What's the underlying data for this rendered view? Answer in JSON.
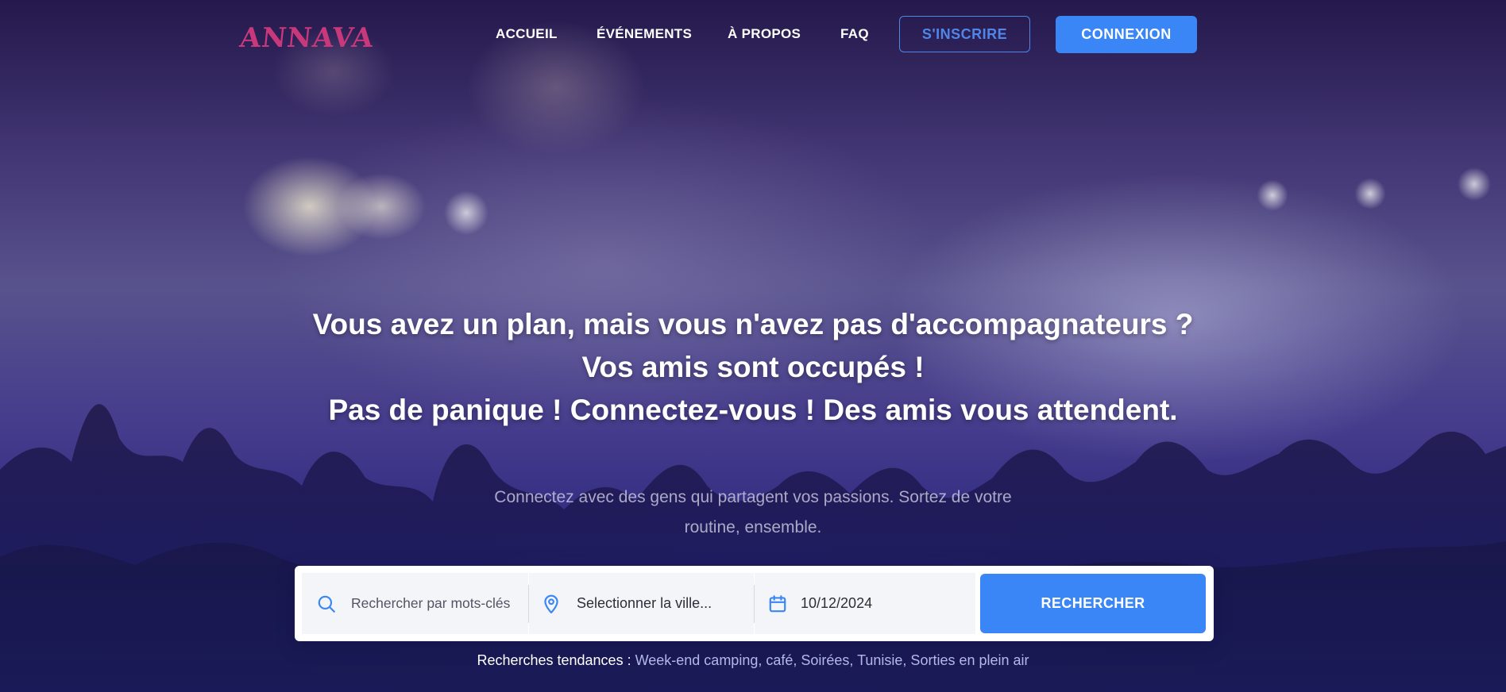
{
  "brand": {
    "logo_text": "ANNAVA",
    "logo_color": "#c8387a"
  },
  "nav": {
    "links": [
      {
        "label": "ACCUEIL"
      },
      {
        "label": "ÉVÉNEMENTS"
      },
      {
        "label": "À PROPOS"
      },
      {
        "label": "FAQ"
      }
    ],
    "register_label": "S'INSCRIRE",
    "login_label": "CONNEXION"
  },
  "hero": {
    "headline_lines": [
      "Vous avez un plan, mais vous n'avez pas d'accompagnateurs ?",
      "Vos amis sont occupés !",
      "Pas de panique ! Connectez-vous ! Des amis vous attendent."
    ],
    "subtext_lines": [
      "Connectez avec des gens qui partagent vos passions. Sortez de votre",
      "routine, ensemble."
    ]
  },
  "search": {
    "keyword_placeholder": "Rechercher par mots-clés",
    "city_value": "Selectionner la ville...",
    "date_value": "10/12/2024",
    "button_label": "RECHERCHER",
    "icons": [
      "search-icon",
      "map-pin-icon",
      "calendar-icon"
    ]
  },
  "trending": {
    "label": "Recherches tendances :",
    "items": "Week-end camping, café, Soirées, Tunisie, Sorties en plein air"
  },
  "colors": {
    "accent": "#3a86f6",
    "register_outline": "#4f86e8"
  }
}
